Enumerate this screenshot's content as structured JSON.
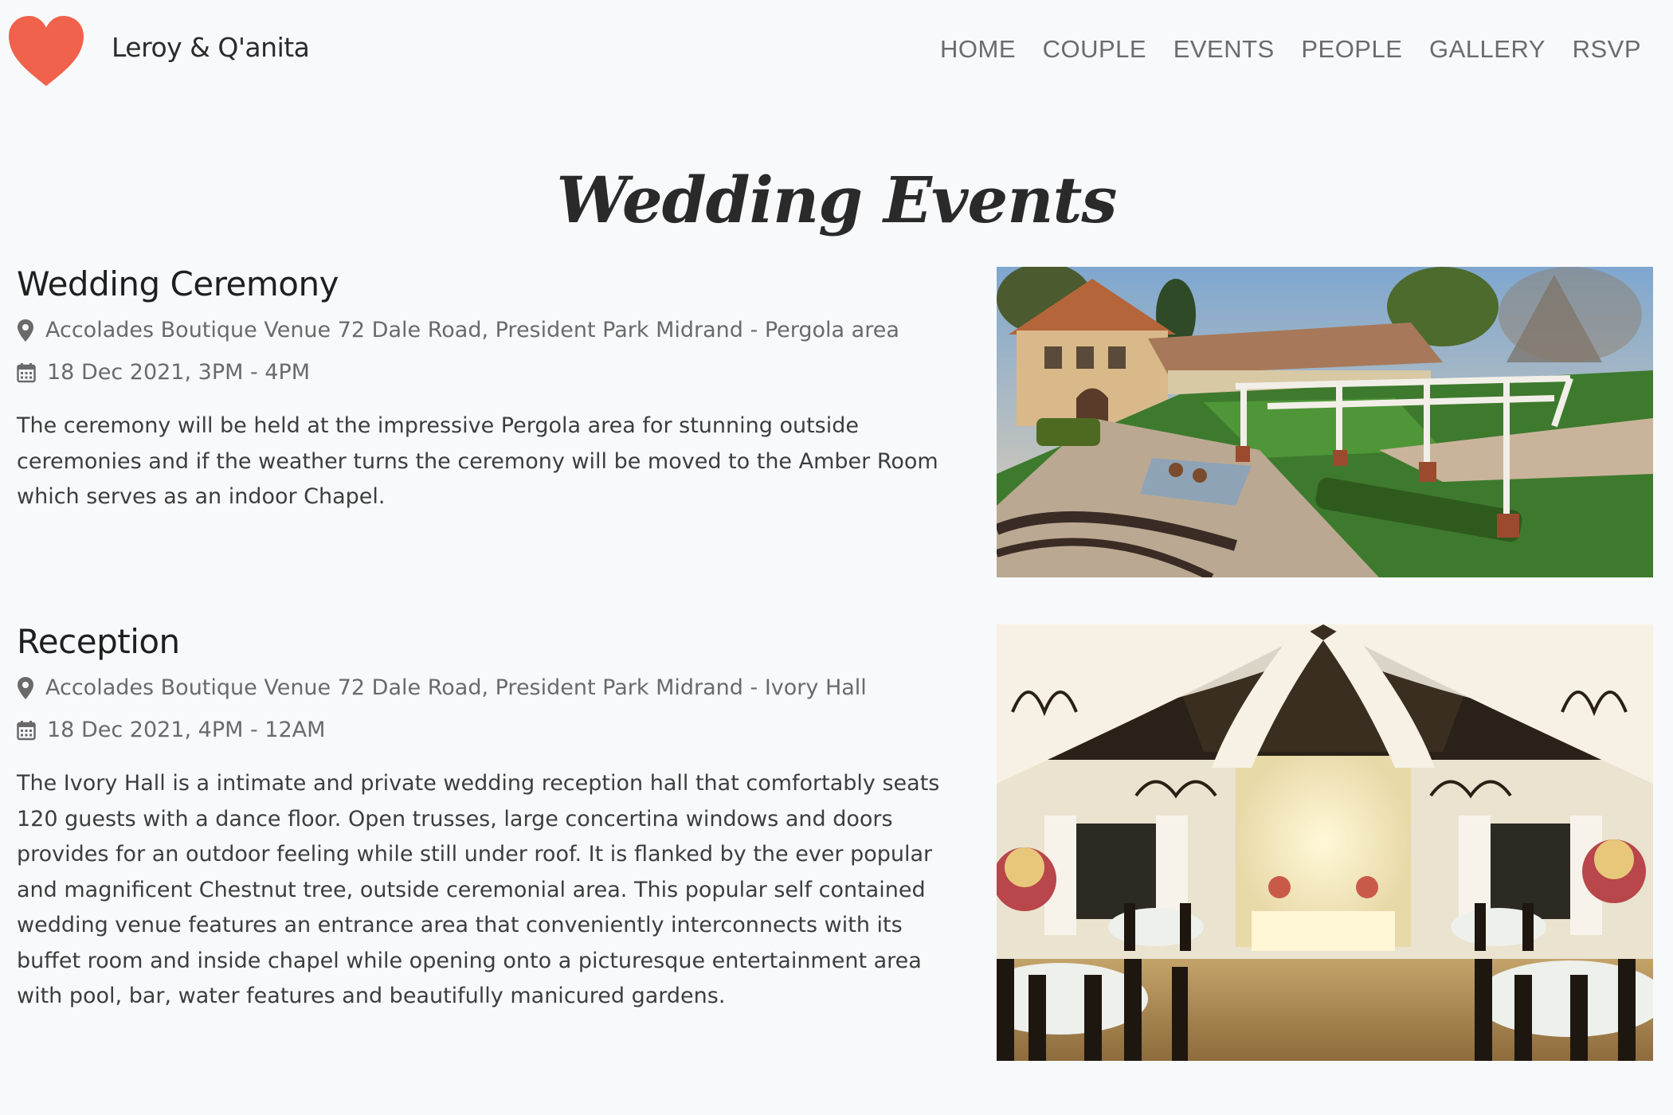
{
  "header": {
    "brand": "Leroy & Q'anita",
    "logo_icon": "heart-icon",
    "logo_color": "#f0624b",
    "nav": [
      {
        "label": "HOME"
      },
      {
        "label": "COUPLE"
      },
      {
        "label": "EVENTS"
      },
      {
        "label": "PEOPLE"
      },
      {
        "label": "GALLERY"
      },
      {
        "label": "RSVP"
      }
    ]
  },
  "page": {
    "title": "Wedding Events"
  },
  "events": [
    {
      "title": "Wedding Ceremony",
      "location_icon": "map-pin-icon",
      "location": "Accolades Boutique Venue 72 Dale Road, President Park Midrand - Pergola area",
      "date_icon": "calendar-icon",
      "datetime": "18 Dec 2021, 3PM - 4PM",
      "description": "The ceremony will be held at the impressive Pergola area for stunning outside ceremonies and if the weather turns the ceremony will be moved to the Amber Room which serves as an indoor Chapel."
    },
    {
      "title": "Reception",
      "location_icon": "map-pin-icon",
      "location": "Accolades Boutique Venue 72 Dale Road, President Park Midrand - Ivory Hall",
      "date_icon": "calendar-icon",
      "datetime": "18 Dec 2021, 4PM - 12AM",
      "description": "The Ivory Hall is a intimate and private wedding reception hall that comfortably seats 120 guests with a dance floor. Open trusses, large concertina windows and doors provides for an outdoor feeling while still under roof. It is flanked by the ever popular and magnificent Chestnut tree, outside ceremonial area. This popular self contained wedding venue features an entrance area that conveniently interconnects with its buffet room and inside chapel while opening onto a picturesque entertainment area with pool, bar, water features and beautifully manicured gardens."
    }
  ]
}
